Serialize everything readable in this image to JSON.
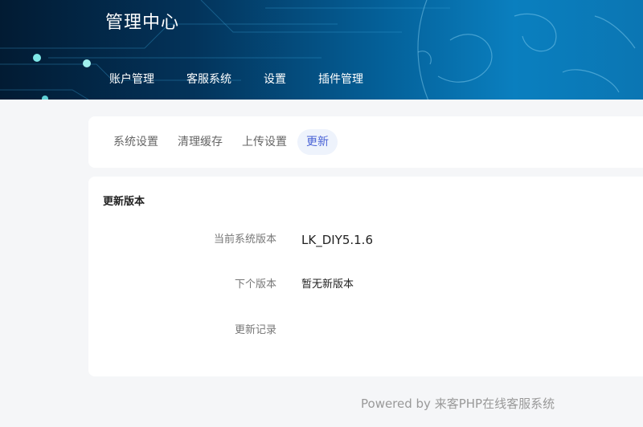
{
  "header": {
    "app_title": "管理中心",
    "nav": [
      "账户管理",
      "客服系统",
      "设置",
      "插件管理"
    ]
  },
  "settings_tabs": [
    "系统设置",
    "清理缓存",
    "上传设置",
    "更新"
  ],
  "active_tab": "更新",
  "update": {
    "section_title": "更新版本",
    "current_version_label": "当前系统版本",
    "current_version_value": "LK_DIY5.1.6",
    "next_version_label": "下个版本",
    "next_version_value": "暂无新版本",
    "changelog_label": "更新记录",
    "changelog_value": ""
  },
  "footer": {
    "text": "Powered by 来客PHP在线客服系统"
  },
  "colors": {
    "header_dark": "#021b33",
    "header_light": "#0a7fbf",
    "active_tab_text": "#4a63d6",
    "active_tab_bg": "#eef3fc",
    "page_bg": "#f5f6f8"
  }
}
